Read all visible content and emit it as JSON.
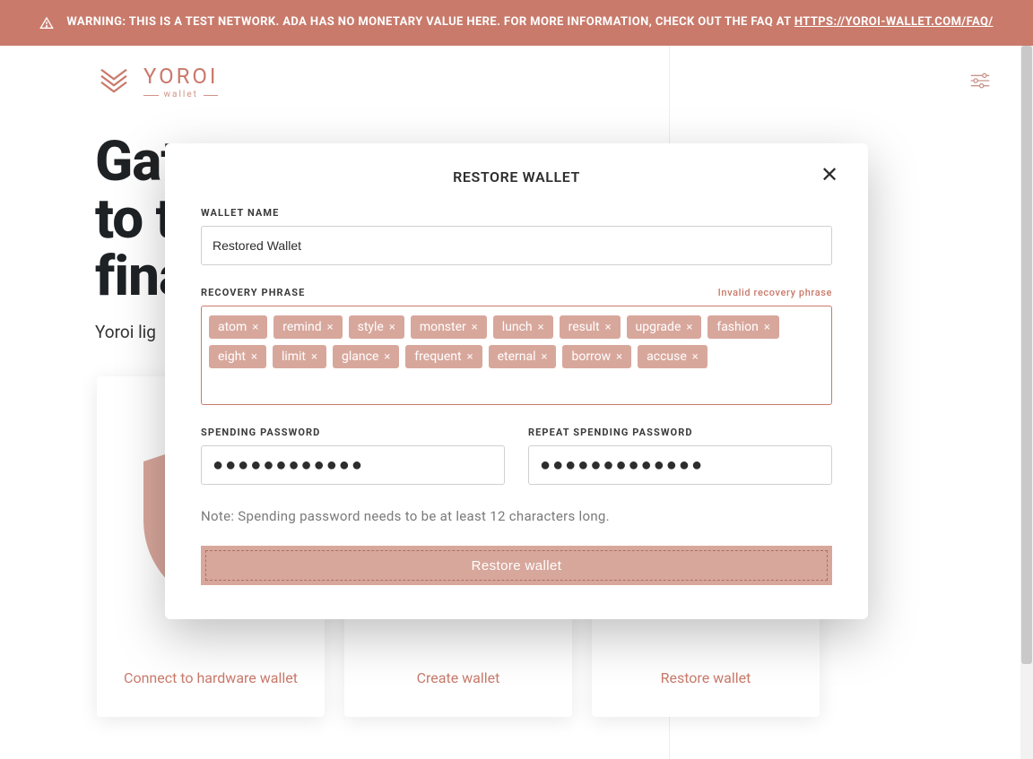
{
  "banner": {
    "prefix": "WARNING: THIS IS A TEST NETWORK. ADA HAS NO MONETARY VALUE HERE. FOR MORE INFORMATION, CHECK OUT THE FAQ AT ",
    "link_text": "HTTPS://YOROI-WALLET.COM/FAQ/"
  },
  "logo": {
    "name": "YOROI",
    "sub": "wallet"
  },
  "hero": {
    "line1": "Gat",
    "line2": "to t",
    "line3": "fina",
    "subtitle": "Yoroi lig"
  },
  "cards": {
    "hardware": "Connect to hardware wallet",
    "create": "Create wallet",
    "restore": "Restore wallet"
  },
  "modal": {
    "title": "RESTORE WALLET",
    "wallet_name_label": "WALLET NAME",
    "wallet_name_value": "Restored Wallet",
    "recovery_label": "RECOVERY PHRASE",
    "recovery_error": "Invalid recovery phrase",
    "phrase": [
      "atom",
      "remind",
      "style",
      "monster",
      "lunch",
      "result",
      "upgrade",
      "fashion",
      "eight",
      "limit",
      "glance",
      "frequent",
      "eternal",
      "borrow",
      "accuse"
    ],
    "spending_label": "SPENDING PASSWORD",
    "repeat_label": "REPEAT SPENDING PASSWORD",
    "spending_value": "●●●●●●●●●●●●",
    "repeat_value": "●●●●●●●●●●●●●",
    "note": "Note: Spending password needs to be at least 12 characters long.",
    "submit": "Restore wallet"
  }
}
